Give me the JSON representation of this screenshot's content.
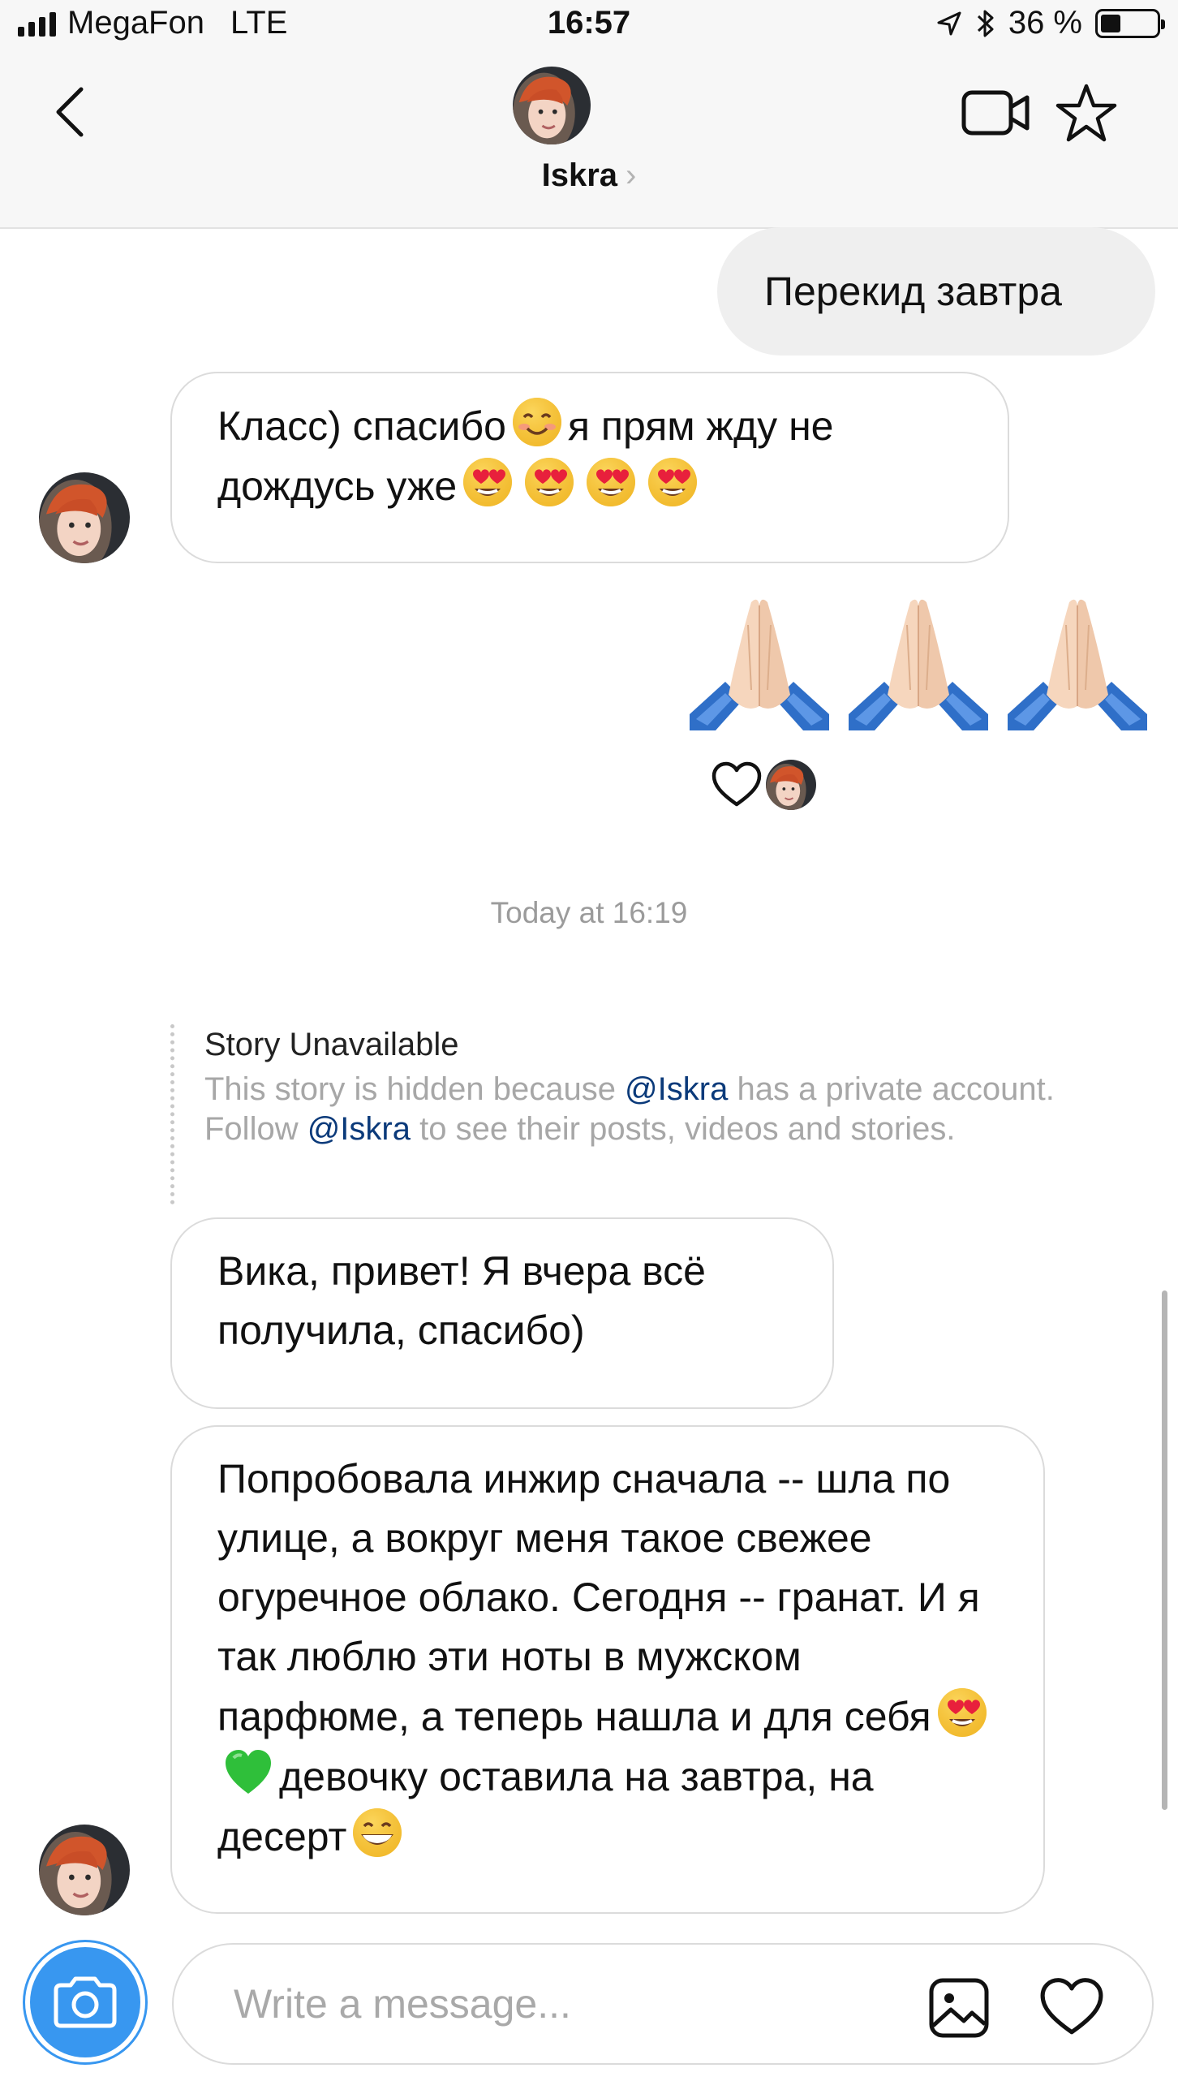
{
  "status_bar": {
    "carrier": "MegaFon",
    "network": "LTE",
    "time": "16:57",
    "battery": "36 %",
    "battery_level": 0.36,
    "icons": [
      "signal-icon",
      "location-icon",
      "bluetooth-icon",
      "battery-icon"
    ]
  },
  "header": {
    "name": "Iskra",
    "chevron": "›",
    "icons": [
      "back-icon",
      "video-call-icon",
      "star-icon"
    ]
  },
  "messages": [
    {
      "side": "out",
      "text": "Перекид завтра"
    },
    {
      "side": "in",
      "text_parts": [
        "Класс) спасибо",
        "я прям жду не дождусь уже"
      ],
      "emoji": [
        "smiling-face",
        "heart-eyes",
        "heart-eyes",
        "heart-eyes",
        "heart-eyes"
      ]
    },
    {
      "side": "out",
      "emoji": [
        "folded-hands",
        "folded-hands",
        "folded-hands"
      ]
    },
    {
      "side": "in",
      "text": "Вика, привет! Я вчера всё получила, спасибо)"
    },
    {
      "side": "in",
      "text_parts": [
        "Попробовала инжир сначала -- шла по улице, а вокруг меня такое свежее огуречное облако. Сегодня -- гранат. И я так люблю эти ноты в мужском парфюме, а теперь нашла и для себя",
        "девочку оставила на завтра, на десерт"
      ],
      "emoji": [
        "heart-eyes",
        "green-heart",
        "grinning-face"
      ]
    }
  ],
  "reaction": {
    "icon": "heart-outline-icon"
  },
  "timestamp": "Today at 16:19",
  "story": {
    "title": "Story Unavailable",
    "text_1": "This story is hidden because ",
    "mention_1": "@Iskra",
    "text_2": " has a private account. Follow ",
    "mention_2": "@Iskra",
    "text_3": " to see their posts, videos and stories."
  },
  "composer": {
    "placeholder": "Write a message...",
    "icons": [
      "camera-icon",
      "gallery-icon",
      "heart-icon"
    ]
  },
  "colors": {
    "accent": "#3897f0",
    "mention": "#0b3a7a",
    "bubble_out": "#efefef",
    "bubble_border": "#dbdbdb",
    "meta_text": "#9b9b9b"
  }
}
